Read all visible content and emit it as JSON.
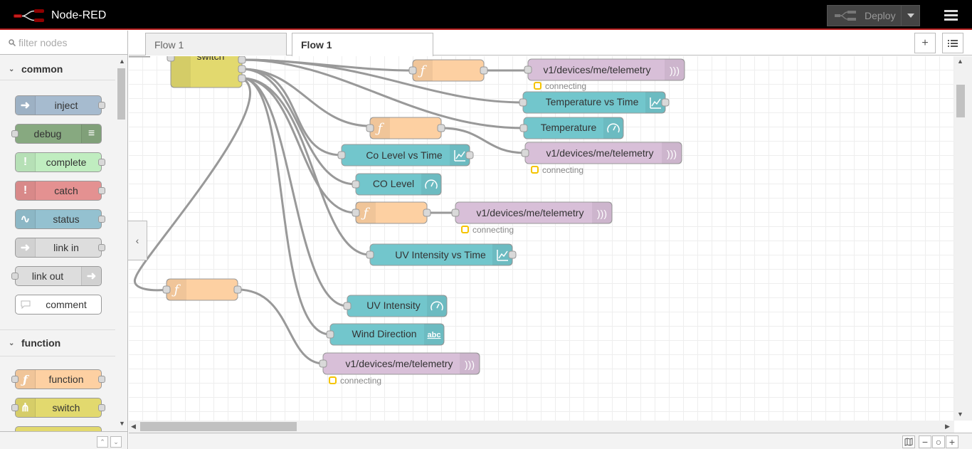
{
  "app": {
    "title": "Node-RED",
    "deploy_label": "Deploy"
  },
  "palette": {
    "search_placeholder": "filter nodes",
    "categories": [
      {
        "label": "common"
      },
      {
        "label": "function"
      }
    ],
    "common_nodes": [
      "inject",
      "debug",
      "complete",
      "catch",
      "status",
      "link in",
      "link out",
      "comment"
    ],
    "function_nodes": [
      "function",
      "switch"
    ]
  },
  "tabs": [
    {
      "label": "Flow 1"
    },
    {
      "label": "Flow 1"
    }
  ],
  "flow": {
    "switch_label": "switch",
    "nodes": {
      "mqtt1": "v1/devices/me/telemetry",
      "mqtt2": "v1/devices/me/telemetry",
      "mqtt3": "v1/devices/me/telemetry",
      "mqtt4": "v1/devices/me/telemetry",
      "temp_chart": "Temperature vs Time",
      "temp_gauge": "Temperature",
      "co_chart": "Co Level vs Time",
      "co_gauge": "CO Level",
      "uv_chart": "UV Intensity vs Time",
      "uv_gauge": "UV Intensity",
      "wind_text": "Wind Direction"
    },
    "status_text": "connecting"
  },
  "colors": {
    "function": "#fdd0a2",
    "switch": "#e2d96e",
    "dashboard": "#72c6cc",
    "mqtt": "#d8bfd8",
    "inject": "#a6bbcf",
    "debug": "#87a980",
    "complete": "#c0edc0",
    "catch": "#e49191",
    "status": "#94c1d0",
    "link": "#dddddd",
    "comment": "#ffffff",
    "status_dot": "#f5c400"
  }
}
